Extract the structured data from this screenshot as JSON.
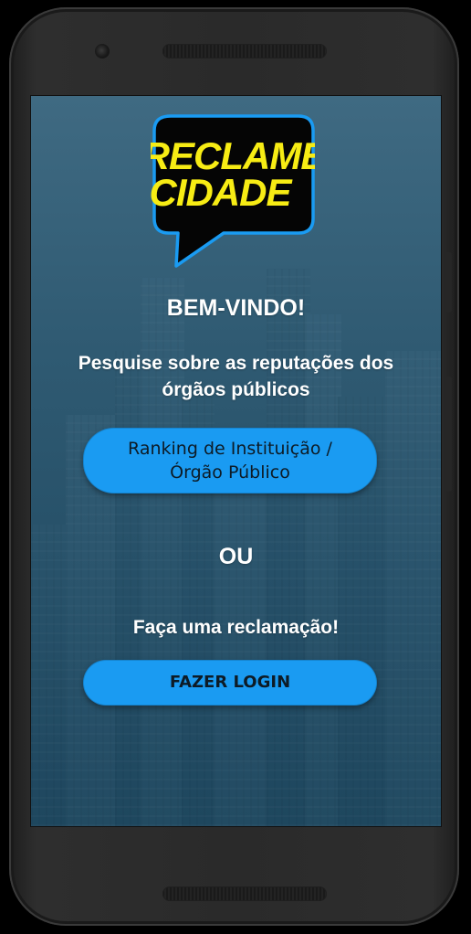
{
  "logo": {
    "line1": "RECLAME",
    "line2": "CIDADE",
    "text_color": "#f7ec14",
    "bubble_color": "#050505",
    "border_color": "#1a9bf2"
  },
  "welcome": {
    "title": "BEM-VINDO!",
    "subtitle": "Pesquise sobre as reputações dos órgãos públicos"
  },
  "ranking_button": {
    "label": "Ranking de Instituição / Órgão Público"
  },
  "separator": "OU",
  "complaint": {
    "prompt": "Faça uma reclamação!",
    "login_label": "FAZER LOGIN"
  },
  "colors": {
    "button": "#1a9bf2",
    "background": "#2f5a72",
    "text": "#ffffff"
  }
}
